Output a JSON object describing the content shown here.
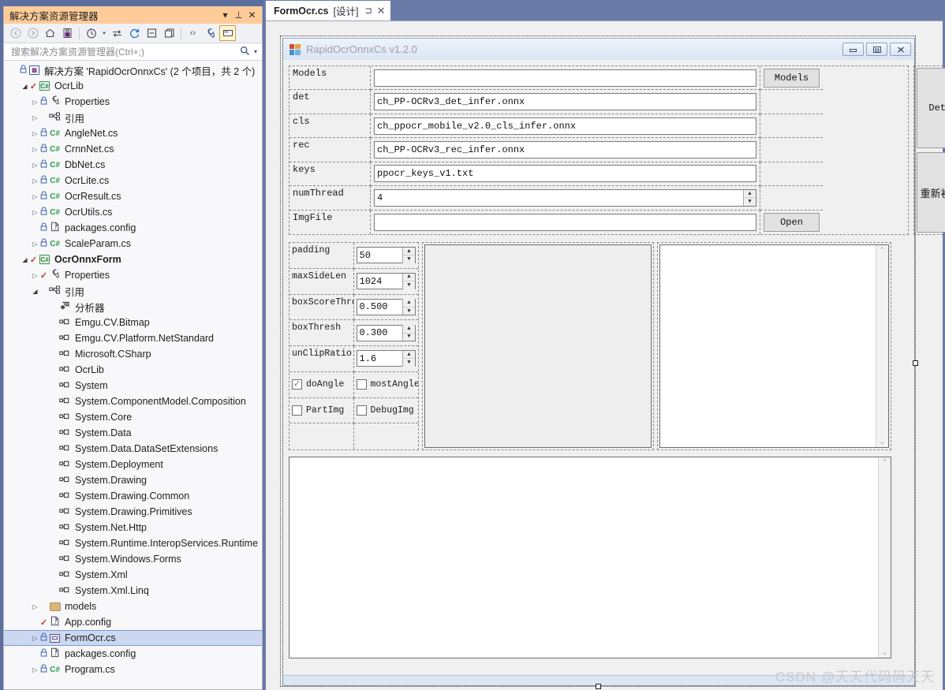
{
  "solution_explorer": {
    "title": "解决方案资源管理器",
    "titlebar_buttons": [
      {
        "name": "dropdown-icon",
        "glyph": "▾"
      },
      {
        "name": "pin-icon",
        "glyph": "⊥"
      },
      {
        "name": "close-icon",
        "glyph": "✕"
      }
    ],
    "toolbar": [
      {
        "name": "back-icon",
        "glyph": "◀"
      },
      {
        "name": "forward-icon",
        "glyph": "▶"
      },
      {
        "name": "home-icon",
        "glyph": "⌂"
      },
      {
        "name": "sync-with-document-icon",
        "glyph": "▤"
      },
      {
        "name": "pending-changes-icon",
        "glyph": "◷"
      },
      {
        "name": "pending-changes-caret-icon",
        "glyph": "▾"
      },
      {
        "name": "show-all-files-icon",
        "glyph": "⇆"
      },
      {
        "name": "refresh-icon",
        "glyph": "↻"
      },
      {
        "name": "collapse-all-icon",
        "glyph": "▣"
      },
      {
        "name": "new-folder-icon",
        "glyph": "❐"
      },
      {
        "name": "view-code-icon",
        "glyph": "‹›"
      },
      {
        "name": "properties-icon",
        "glyph": "🔧"
      },
      {
        "name": "view-designer-icon",
        "glyph": "▭"
      }
    ],
    "search": {
      "placeholder": "搜索解决方案资源管理器(Ctrl+;)",
      "value": "",
      "icon": "search-icon",
      "caret": "▾"
    },
    "tree": [
      {
        "label": "解决方案 'RapidOcrOnnxCs' (2 个项目，共 2 个)",
        "indent": 0,
        "expander": "",
        "lock": true,
        "check": false,
        "icon": "solution-icon",
        "bold": false,
        "selected": false
      },
      {
        "label": "OcrLib",
        "indent": 1,
        "expander": "open",
        "lock": false,
        "check": true,
        "icon": "csproj-icon",
        "bold": false,
        "selected": false
      },
      {
        "label": "Properties",
        "indent": 2,
        "expander": "closed",
        "lock": true,
        "check": false,
        "icon": "wrench-icon",
        "bold": false,
        "selected": false
      },
      {
        "label": "引用",
        "indent": 2,
        "expander": "closed",
        "lock": false,
        "check": false,
        "icon": "references-icon",
        "bold": false,
        "selected": false
      },
      {
        "label": "AngleNet.cs",
        "indent": 2,
        "expander": "closed",
        "lock": true,
        "check": false,
        "icon": "csharp-icon",
        "bold": false,
        "selected": false
      },
      {
        "label": "CrnnNet.cs",
        "indent": 2,
        "expander": "closed",
        "lock": true,
        "check": false,
        "icon": "csharp-icon",
        "bold": false,
        "selected": false
      },
      {
        "label": "DbNet.cs",
        "indent": 2,
        "expander": "closed",
        "lock": true,
        "check": false,
        "icon": "csharp-icon",
        "bold": false,
        "selected": false
      },
      {
        "label": "OcrLite.cs",
        "indent": 2,
        "expander": "closed",
        "lock": true,
        "check": false,
        "icon": "csharp-icon",
        "bold": false,
        "selected": false
      },
      {
        "label": "OcrResult.cs",
        "indent": 2,
        "expander": "closed",
        "lock": true,
        "check": false,
        "icon": "csharp-icon",
        "bold": false,
        "selected": false
      },
      {
        "label": "OcrUtils.cs",
        "indent": 2,
        "expander": "closed",
        "lock": true,
        "check": false,
        "icon": "csharp-icon",
        "bold": false,
        "selected": false
      },
      {
        "label": "packages.config",
        "indent": 2,
        "expander": "",
        "lock": true,
        "check": false,
        "icon": "config-icon",
        "bold": false,
        "selected": false
      },
      {
        "label": "ScaleParam.cs",
        "indent": 2,
        "expander": "closed",
        "lock": true,
        "check": false,
        "icon": "csharp-icon",
        "bold": false,
        "selected": false
      },
      {
        "label": "OcrOnnxForm",
        "indent": 1,
        "expander": "open",
        "lock": false,
        "check": true,
        "icon": "csproj-icon",
        "bold": true,
        "selected": false
      },
      {
        "label": "Properties",
        "indent": 2,
        "expander": "closed",
        "lock": false,
        "check": true,
        "icon": "wrench-icon",
        "bold": false,
        "selected": false
      },
      {
        "label": "引用",
        "indent": 2,
        "expander": "open",
        "lock": false,
        "check": false,
        "icon": "references-icon",
        "bold": false,
        "selected": false
      },
      {
        "label": "分析器",
        "indent": 3,
        "expander": "",
        "lock": false,
        "check": false,
        "icon": "analyzer-icon",
        "bold": false,
        "selected": false
      },
      {
        "label": "Emgu.CV.Bitmap",
        "indent": 3,
        "expander": "",
        "lock": false,
        "check": false,
        "icon": "assembly-icon",
        "bold": false,
        "selected": false
      },
      {
        "label": "Emgu.CV.Platform.NetStandard",
        "indent": 3,
        "expander": "",
        "lock": false,
        "check": false,
        "icon": "assembly-icon",
        "bold": false,
        "selected": false
      },
      {
        "label": "Microsoft.CSharp",
        "indent": 3,
        "expander": "",
        "lock": false,
        "check": false,
        "icon": "assembly-icon",
        "bold": false,
        "selected": false
      },
      {
        "label": "OcrLib",
        "indent": 3,
        "expander": "",
        "lock": false,
        "check": false,
        "icon": "assembly-icon",
        "bold": false,
        "selected": false
      },
      {
        "label": "System",
        "indent": 3,
        "expander": "",
        "lock": false,
        "check": false,
        "icon": "assembly-icon",
        "bold": false,
        "selected": false
      },
      {
        "label": "System.ComponentModel.Composition",
        "indent": 3,
        "expander": "",
        "lock": false,
        "check": false,
        "icon": "assembly-icon",
        "bold": false,
        "selected": false
      },
      {
        "label": "System.Core",
        "indent": 3,
        "expander": "",
        "lock": false,
        "check": false,
        "icon": "assembly-icon",
        "bold": false,
        "selected": false
      },
      {
        "label": "System.Data",
        "indent": 3,
        "expander": "",
        "lock": false,
        "check": false,
        "icon": "assembly-icon",
        "bold": false,
        "selected": false
      },
      {
        "label": "System.Data.DataSetExtensions",
        "indent": 3,
        "expander": "",
        "lock": false,
        "check": false,
        "icon": "assembly-icon",
        "bold": false,
        "selected": false
      },
      {
        "label": "System.Deployment",
        "indent": 3,
        "expander": "",
        "lock": false,
        "check": false,
        "icon": "assembly-icon",
        "bold": false,
        "selected": false
      },
      {
        "label": "System.Drawing",
        "indent": 3,
        "expander": "",
        "lock": false,
        "check": false,
        "icon": "assembly-icon",
        "bold": false,
        "selected": false
      },
      {
        "label": "System.Drawing.Common",
        "indent": 3,
        "expander": "",
        "lock": false,
        "check": false,
        "icon": "assembly-icon",
        "bold": false,
        "selected": false
      },
      {
        "label": "System.Drawing.Primitives",
        "indent": 3,
        "expander": "",
        "lock": false,
        "check": false,
        "icon": "assembly-icon",
        "bold": false,
        "selected": false
      },
      {
        "label": "System.Net.Http",
        "indent": 3,
        "expander": "",
        "lock": false,
        "check": false,
        "icon": "assembly-icon",
        "bold": false,
        "selected": false
      },
      {
        "label": "System.Runtime.InteropServices.Runtime",
        "indent": 3,
        "expander": "",
        "lock": false,
        "check": false,
        "icon": "assembly-icon",
        "bold": false,
        "selected": false
      },
      {
        "label": "System.Windows.Forms",
        "indent": 3,
        "expander": "",
        "lock": false,
        "check": false,
        "icon": "assembly-icon",
        "bold": false,
        "selected": false
      },
      {
        "label": "System.Xml",
        "indent": 3,
        "expander": "",
        "lock": false,
        "check": false,
        "icon": "assembly-icon",
        "bold": false,
        "selected": false
      },
      {
        "label": "System.Xml.Linq",
        "indent": 3,
        "expander": "",
        "lock": false,
        "check": false,
        "icon": "assembly-icon",
        "bold": false,
        "selected": false
      },
      {
        "label": "models",
        "indent": 2,
        "expander": "closed",
        "lock": false,
        "check": false,
        "icon": "folder-icon",
        "bold": false,
        "selected": false
      },
      {
        "label": "App.config",
        "indent": 2,
        "expander": "",
        "lock": false,
        "check": true,
        "icon": "config-icon",
        "bold": false,
        "selected": false
      },
      {
        "label": "FormOcr.cs",
        "indent": 2,
        "expander": "closed",
        "lock": true,
        "check": false,
        "icon": "winform-icon",
        "bold": false,
        "selected": true
      },
      {
        "label": "packages.config",
        "indent": 2,
        "expander": "",
        "lock": true,
        "check": false,
        "icon": "config-icon",
        "bold": false,
        "selected": false
      },
      {
        "label": "Program.cs",
        "indent": 2,
        "expander": "closed",
        "lock": true,
        "check": false,
        "icon": "csharp-icon",
        "bold": false,
        "selected": false
      }
    ]
  },
  "designer": {
    "tab": {
      "name": "FormOcr.cs",
      "suffix": "[设计]",
      "pin_icon": "⊐",
      "close_icon": "✕"
    },
    "form": {
      "caption": "RapidOcrOnnxCs v1.2.0",
      "icon": "winform-app-icon",
      "window_buttons": [
        {
          "name": "minimize-button",
          "glyph": "▬"
        },
        {
          "name": "maximize-button",
          "glyph": "❐"
        },
        {
          "name": "close-button",
          "glyph": "✕"
        }
      ],
      "config_rows": [
        {
          "label": "Models",
          "value": "",
          "button": "Models",
          "spinner": false
        },
        {
          "label": "det",
          "value": "ch_PP-OCRv3_det_infer.onnx",
          "button": "",
          "spinner": false
        },
        {
          "label": "cls",
          "value": "ch_ppocr_mobile_v2.0_cls_infer.onnx",
          "button": "",
          "spinner": false
        },
        {
          "label": "rec",
          "value": "ch_PP-OCRv3_rec_infer.onnx",
          "button": "",
          "spinner": false
        },
        {
          "label": "keys",
          "value": "ppocr_keys_v1.txt",
          "button": "",
          "spinner": false
        },
        {
          "label": "numThread",
          "value": "4",
          "button": "",
          "spinner": true
        },
        {
          "label": "ImgFile",
          "value": "",
          "button": "Open",
          "spinner": false
        }
      ],
      "action_buttons": [
        {
          "label": "Detect",
          "cjk": false
        },
        {
          "label": "重新初始化",
          "cjk": true
        }
      ],
      "param_rows": [
        {
          "label": "padding",
          "value": "50"
        },
        {
          "label": "maxSideLen",
          "value": "1024"
        },
        {
          "label": "boxScoreThresh",
          "value": "0.500"
        },
        {
          "label": "boxThresh",
          "value": "0.300"
        },
        {
          "label": "unClipRatio",
          "value": "1.6"
        }
      ],
      "checkboxes": [
        {
          "label": "doAngle",
          "checked": true
        },
        {
          "label": "mostAngle",
          "checked": false
        },
        {
          "label": "PartImg",
          "checked": false
        },
        {
          "label": "DebugImg",
          "checked": false
        }
      ],
      "scroll_up_glyph": "⌃",
      "scroll_down_glyph": "⌄"
    }
  },
  "watermark": "CSDN @天天代码码天天"
}
